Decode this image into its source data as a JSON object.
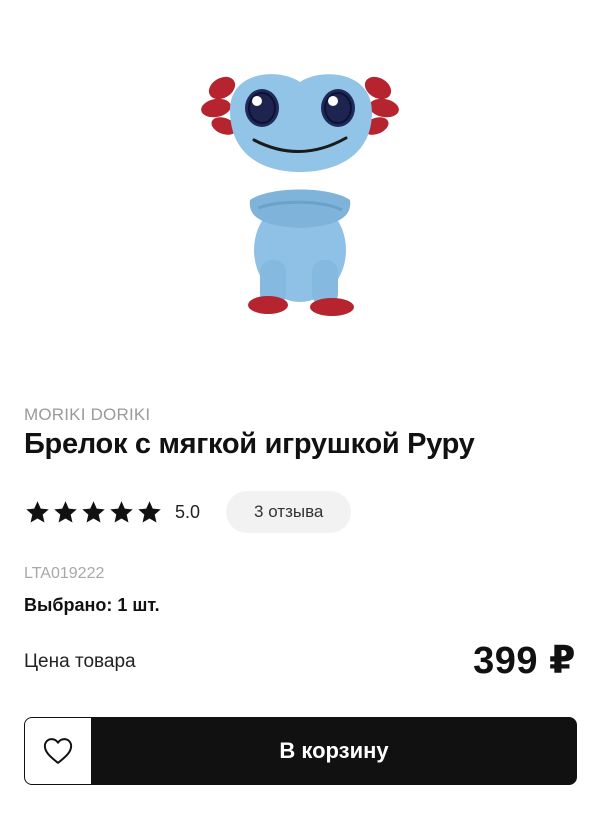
{
  "product": {
    "brand": "MORIKI DORIKI",
    "title": "Брелок с мягкой игрушкой Руру",
    "rating": {
      "stars_filled": 5,
      "stars_total": 5,
      "value": "5.0",
      "reviews_label": "3 отзыва"
    },
    "sku": "LTA019222",
    "selected": "Выбрано: 1 шт.",
    "price_label": "Цена товара",
    "price": "399 ₽",
    "image_icon": "plush-toy-image"
  },
  "actions": {
    "favorite_icon": "heart-icon",
    "add_to_cart_label": "В корзину"
  },
  "colors": {
    "toy_body": "#8fc1e6",
    "toy_accent": "#b5242f",
    "button_bg": "#111111",
    "chip_bg": "#f2f2f2",
    "muted_text": "#9a9a9a"
  }
}
